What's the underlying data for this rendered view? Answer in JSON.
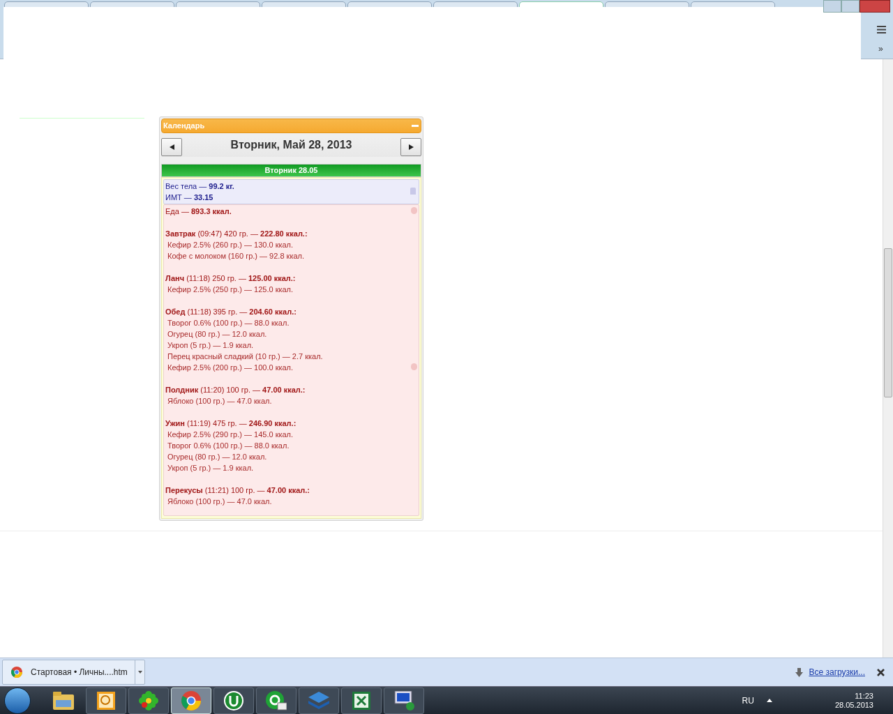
{
  "browser": {
    "tabs": [
      {
        "selected": false
      },
      {
        "selected": false
      },
      {
        "selected": false
      },
      {
        "selected": false
      },
      {
        "selected": false
      },
      {
        "selected": false
      },
      {
        "selected": true
      },
      {
        "selected": false
      },
      {
        "selected": false
      }
    ],
    "overflow": "»"
  },
  "calendar": {
    "title": "Календарь",
    "date": "Вторник, Май 28, 2013",
    "day_header": "Вторник 28.05",
    "body_lines": [
      "Вес тела — **99.2 кг.**",
      "ИМТ — **33.15**"
    ],
    "food_total": "Еда — **893.3 ккал.**",
    "meals": [
      {
        "header": "**Завтрак** (09:47) 420 гр. — **222.80 ккал.:**",
        "items": [
          "Кефир 2.5% (260 гр.) — 130.0 ккал.",
          "Кофе с молоком (160 гр.) — 92.8 ккал."
        ]
      },
      {
        "header": "**Ланч** (11:18) 250 гр. — **125.00 ккал.:**",
        "items": [
          "Кефир 2.5% (250 гр.) — 125.0 ккал."
        ]
      },
      {
        "header": "**Обед** (11:18) 395 гр. — **204.60 ккал.:**",
        "items": [
          "Творог 0.6% (100 гр.) — 88.0 ккал.",
          "Огурец (80 гр.) — 12.0 ккал.",
          "Укроп (5 гр.) — 1.9 ккал.",
          "Перец красный сладкий (10 гр.) — 2.7 ккал.",
          "Кефир 2.5% (200 гр.) — 100.0 ккал."
        ]
      },
      {
        "header": "**Полдник** (11:20) 100 гр. — **47.00 ккал.:**",
        "items": [
          "Яблоко (100 гр.) — 47.0 ккал."
        ]
      },
      {
        "header": "**Ужин** (11:19) 475 гр. — **246.90 ккал.:**",
        "items": [
          "Кефир 2.5% (290 гр.) — 145.0 ккал.",
          "Творог 0.6% (100 гр.) — 88.0 ккал.",
          "Огурец (80 гр.) — 12.0 ккал.",
          "Укроп (5 гр.) — 1.9 ккал."
        ]
      },
      {
        "header": "**Перекусы** (11:21) 100 гр. — **47.00 ккал.:**",
        "items": [
          "Яблоко (100 гр.) — 47.0 ккал."
        ]
      }
    ]
  },
  "download_bar": {
    "file": "Стартовая • Личны....htm",
    "link": "Все загрузки..."
  },
  "taskbar": {
    "apps": [
      {
        "kind": "folder",
        "selected": false
      },
      {
        "kind": "calendar",
        "selected": false
      },
      {
        "kind": "flower",
        "selected": false
      },
      {
        "kind": "chrome",
        "selected": true
      },
      {
        "kind": "torrent",
        "selected": false
      },
      {
        "kind": "mail",
        "selected": false
      },
      {
        "kind": "stack",
        "selected": false
      },
      {
        "kind": "sheet",
        "selected": false
      },
      {
        "kind": "monitor",
        "selected": false
      }
    ],
    "language": "RU",
    "time": "11:23",
    "date": "28.05.2013"
  }
}
